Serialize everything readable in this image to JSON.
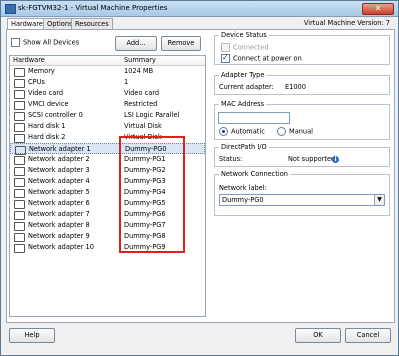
{
  "window": {
    "title": "sk-FGTVM32-1 - Virtual Machine Properties"
  },
  "tabs": [
    "Hardware",
    "Options",
    "Resources"
  ],
  "version": "Virtual Machine Version: 7",
  "toolbar": {
    "show_all": "Show All Devices",
    "add": "Add...",
    "remove": "Remove"
  },
  "hardware": {
    "col_hardware": "Hardware",
    "col_summary": "Summary",
    "rows": [
      {
        "name": "Memory",
        "summary": "1024 MB",
        "icon": "memory-icon"
      },
      {
        "name": "CPUs",
        "summary": "1",
        "icon": "cpu-icon"
      },
      {
        "name": "Video card",
        "summary": "Video card",
        "icon": "video-card-icon"
      },
      {
        "name": "VMCI device",
        "summary": "Restricted",
        "icon": "vmci-icon"
      },
      {
        "name": "SCSI controller 0",
        "summary": "LSI Logic Parallel",
        "icon": "scsi-icon"
      },
      {
        "name": "Hard disk 1",
        "summary": "Virtual Disk",
        "icon": "disk-icon"
      },
      {
        "name": "Hard disk 2",
        "summary": "Virtual Disk",
        "icon": "disk-icon"
      },
      {
        "name": "Network adapter 1",
        "summary": "Dummy-PG0",
        "icon": "network-icon"
      },
      {
        "name": "Network adapter 2",
        "summary": "Dummy-PG1",
        "icon": "network-icon"
      },
      {
        "name": "Network adapter 3",
        "summary": "Dummy-PG2",
        "icon": "network-icon"
      },
      {
        "name": "Network adapter 4",
        "summary": "Dummy-PG3",
        "icon": "network-icon"
      },
      {
        "name": "Network adapter 5",
        "summary": "Dummy-PG4",
        "icon": "network-icon"
      },
      {
        "name": "Network adapter 6",
        "summary": "Dummy-PG5",
        "icon": "network-icon"
      },
      {
        "name": "Network adapter 7",
        "summary": "Dummy-PG6",
        "icon": "network-icon"
      },
      {
        "name": "Network adapter 8",
        "summary": "Dummy-PG7",
        "icon": "network-icon"
      },
      {
        "name": "Network adapter 9",
        "summary": "Dummy-PG8",
        "icon": "network-icon"
      },
      {
        "name": "Network adapter 10",
        "summary": "Dummy-PG9",
        "icon": "network-icon"
      }
    ]
  },
  "device_status": {
    "label": "Device Status",
    "connected": "Connected",
    "connect_at_power_on": "Connect at power on"
  },
  "adapter_type": {
    "label": "Adapter Type",
    "current_label": "Current adapter:",
    "current_value": "E1000"
  },
  "mac": {
    "label": "MAC Address",
    "value": "",
    "automatic": "Automatic",
    "manual": "Manual"
  },
  "directpath": {
    "label": "DirectPath I/O",
    "status_label": "Status:",
    "status_value": "Not supported"
  },
  "network_connection": {
    "label": "Network Connection",
    "network_label": "Network label:",
    "selected": "Dummy-PG0"
  },
  "footer": {
    "help": "Help",
    "ok": "OK",
    "cancel": "Cancel"
  },
  "colors": {
    "highlight_box": "#e02020",
    "selected_row": "#dbe6f5"
  }
}
